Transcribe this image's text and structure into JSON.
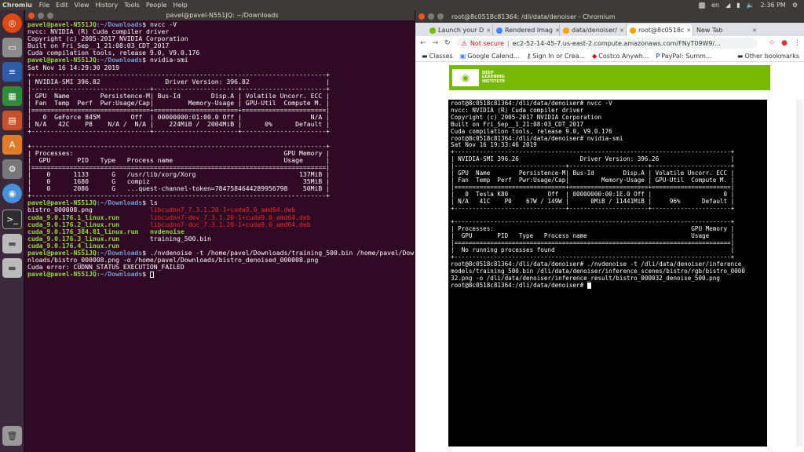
{
  "topbar": {
    "app_name": "Chromiu",
    "menus": [
      "File",
      "Edit",
      "View",
      "History",
      "Tools",
      "People",
      "Help"
    ],
    "lang": "en",
    "time": "2:36 PM"
  },
  "left_terminal": {
    "title": "pavel@pavel-N551JQ: ~/Downloads",
    "prompt_user": "pavel@pavel-N551JQ",
    "prompt_path": ":~/Downloads",
    "lines": [
      {
        "p": true,
        "cmd": "$ nvcc -V"
      },
      {
        "t": "nvcc: NVIDIA (R) Cuda compiler driver"
      },
      {
        "t": "Copyright (c) 2005-2017 NVIDIA Corporation"
      },
      {
        "t": "Built on Fri_Sep__1_21:08:03_CDT_2017"
      },
      {
        "t": "Cuda compilation tools, release 9.0, V9.0.176"
      },
      {
        "p": true,
        "cmd": "$ nvidia-smi"
      },
      {
        "t": "Sat Nov 16 14:29:30 2019"
      },
      {
        "t": "+-----------------------------------------------------------------------------+"
      },
      {
        "t": "| NVIDIA-SMI 396.82                 Driver Version: 396.82                    |"
      },
      {
        "t": "|-------------------------------+----------------------+----------------------+"
      },
      {
        "t": "| GPU  Name        Persistence-M| Bus-Id        Disp.A | Volatile Uncorr. ECC |"
      },
      {
        "t": "| Fan  Temp  Perf  Pwr:Usage/Cap|         Memory-Usage | GPU-Util  Compute M. |"
      },
      {
        "t": "|===============================+======================+======================|"
      },
      {
        "t": "|   0  GeForce 845M        Off  | 00000000:01:00.0 Off |                  N/A |"
      },
      {
        "t": "| N/A   42C    P8    N/A /  N/A |    224MiB /  2004MiB |      0%      Default |"
      },
      {
        "t": "+-------------------------------+----------------------+----------------------+"
      },
      {
        "t": ""
      },
      {
        "t": "+-----------------------------------------------------------------------------+"
      },
      {
        "t": "| Processes:                                                       GPU Memory |"
      },
      {
        "t": "|  GPU       PID   Type   Process name                             Usage      |"
      },
      {
        "t": "|=============================================================================|"
      },
      {
        "t": "|    0      1133      G   /usr/lib/xorg/Xorg                           137MiB |"
      },
      {
        "t": "|    0      1680      G   compiz                                        35MiB |"
      },
      {
        "t": "|    0      2086      G   ...quest-channel-token=7847584644289956798    50MiB |"
      },
      {
        "t": "+-----------------------------------------------------------------------------+"
      },
      {
        "p": true,
        "cmd": "$ ls"
      }
    ],
    "ls": [
      [
        "bistro_000008.png",
        "libcudnn7_7.3.1.20-1+cuda9.0_amd64.deb"
      ],
      [
        "cuda_9.0.176.1_linux.run",
        "libcudnn7-dev_7.3.1.20-1+cuda9.0_amd64.deb"
      ],
      [
        "cuda_9.0.176.2_linux.run",
        "libcudnn7-doc_7.3.1.20-1+cuda9.0_amd64.deb"
      ],
      [
        "cuda_9.0.176_384.81_linux.run",
        "nvdenoise"
      ],
      [
        "cuda_9.0.176.3_linux.run",
        "training_500.bin"
      ],
      [
        "cuda_9.0.176.4_linux.run",
        ""
      ]
    ],
    "cmd_denoise_1": "$ ./nvdenoise -t /home/pavel/Downloads/training_500.bin /home/pavel/Dow",
    "cmd_denoise_2": "nloads/bistro_000008.png -o /home/pavel/Downloads/bistro_denoised_000008.png",
    "error": "Cuda error: CUDNN_STATUS_EXECUTION_FAILED",
    "last_prompt": "$ "
  },
  "chrome": {
    "window_title": "root@8c0518c81364: /dli/data/denoiser - Chromium",
    "tabs": [
      {
        "label": "Launch your D",
        "color": "#76b900"
      },
      {
        "label": "Rendered Imag",
        "color": "#4285f4"
      },
      {
        "label": "data/denoiser/",
        "color": "#f4a300"
      },
      {
        "label": "root@8c0518c",
        "color": "#f4a300",
        "active": true
      },
      {
        "label": "New Tab",
        "color": ""
      }
    ],
    "not_secure": "Not secure",
    "url": "ec2-52-14-45-7.us-east-2.compute.amazonaws.com/FNyT09W9/...",
    "bookmarks": [
      "Classes",
      "Google Calend...",
      "Sign In or Crea...",
      "Costco Anywh...",
      "PayPal: Summ..."
    ],
    "other_bookmarks": "Other bookmarks",
    "brand_lines": [
      "DEEP",
      "LEARNING",
      "INSTITUTE"
    ],
    "logo_text": "NVIDIA",
    "accent": "#76b900"
  },
  "jupyter_terminal": {
    "lines": [
      "root@8c0518c81364:/dli/data/denoiser# nvcc -V",
      "nvcc: NVIDIA (R) Cuda compiler driver",
      "Copyright (c) 2005-2017 NVIDIA Corporation",
      "Built on Fri_Sep__1_21:08:03_CDT_2017",
      "Cuda compilation tools, release 9.0, V9.0.176",
      "root@8c0518c81364:/dli/data/denoiser# nvidia-smi",
      "Sat Nov 16 19:33:46 2019",
      "+-----------------------------------------------------------------------------+",
      "| NVIDIA-SMI 396.26                 Driver Version: 396.26                    |",
      "|-------------------------------+----------------------+----------------------+",
      "| GPU  Name        Persistence-M| Bus-Id        Disp.A | Volatile Uncorr. ECC |",
      "| Fan  Temp  Perf  Pwr:Usage/Cap|         Memory-Usage | GPU-Util  Compute M. |",
      "|===============================+======================+======================|",
      "|   0  Tesla K80           Off  | 00000000:00:1E.0 Off |                    0 |",
      "| N/A   41C    P0    67W / 149W |      0MiB / 11441MiB |     96%      Default |",
      "+-------------------------------+----------------------+----------------------+",
      "",
      "+-----------------------------------------------------------------------------+",
      "| Processes:                                                       GPU Memory |",
      "|  GPU       PID   Type   Process name                             Usage      |",
      "|=============================================================================|",
      "|  No running processes found                                                 |",
      "+-----------------------------------------------------------------------------+",
      "root@8c0518c81364:/dli/data/denoiser# ./nvdenoise -t /dli/data/denoiser/inference_",
      "models/training_500.bin /dli/data/denoiser/inference_scenes/bistro/rgb/bistro_0000",
      "32.png -o /dli/data/denoiser/inference_result/bistro_000032_denoise_500.png"
    ],
    "last_prompt": "root@8c0518c81364:/dli/data/denoiser# "
  }
}
